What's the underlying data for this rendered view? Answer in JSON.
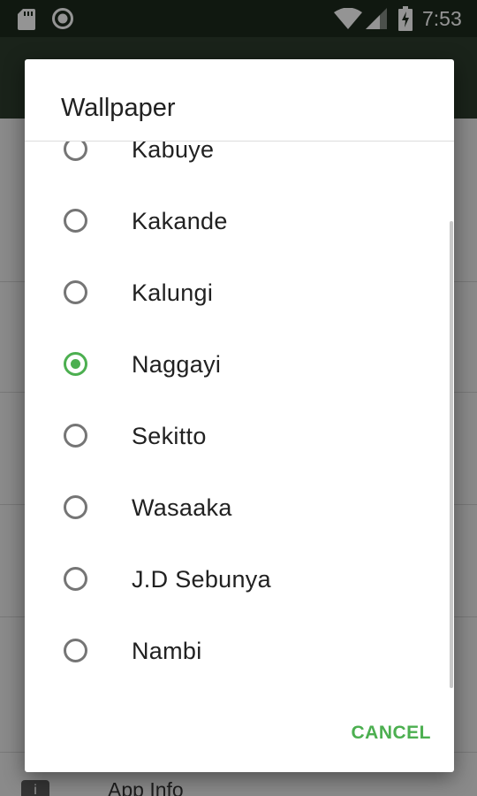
{
  "status_bar": {
    "time": "7:53",
    "icons": [
      "sd-card-icon",
      "record-icon",
      "wifi-icon",
      "signal-icon",
      "battery-charging-icon"
    ]
  },
  "background": {
    "app_info_label": "App Info"
  },
  "dialog": {
    "title": "Wallpaper",
    "options": [
      {
        "label": "Kabuye",
        "selected": false
      },
      {
        "label": "Kakande",
        "selected": false
      },
      {
        "label": "Kalungi",
        "selected": false
      },
      {
        "label": "Naggayi",
        "selected": true
      },
      {
        "label": "Sekitto",
        "selected": false
      },
      {
        "label": "Wasaaka",
        "selected": false
      },
      {
        "label": "J.D Sebunya",
        "selected": false
      },
      {
        "label": "Nambi",
        "selected": false
      }
    ],
    "cancel_label": "CANCEL"
  },
  "colors": {
    "accent": "#4caf50",
    "status_bar": "#1c2a1c",
    "app_bar": "#2e3d2e",
    "radio_unchecked": "#757575"
  }
}
